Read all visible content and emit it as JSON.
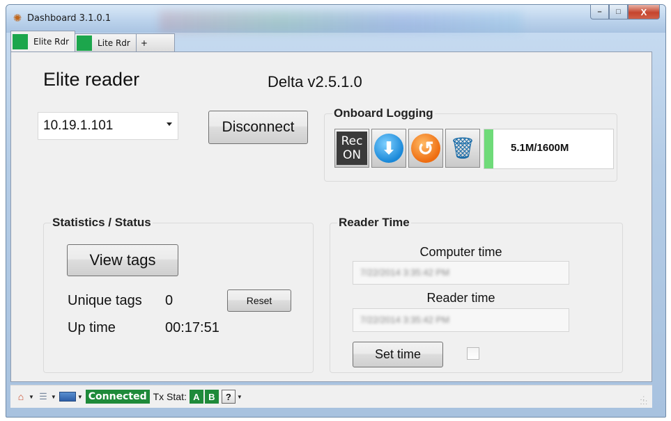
{
  "window": {
    "title": "Dashboard 3.1.0.1",
    "controls": {
      "minimize": "–",
      "maximize": "□",
      "close": "X"
    }
  },
  "tabs": [
    {
      "label": "Elite Rdr",
      "active": true,
      "color": "#1ca64c"
    },
    {
      "label": "Lite Rdr",
      "active": false,
      "color": "#1ca64c"
    },
    {
      "label": "+",
      "active": false
    }
  ],
  "header": {
    "reader_name": "Elite reader",
    "version": "Delta v2.5.1.0"
  },
  "connection": {
    "ip_address": "10.19.1.101",
    "disconnect_label": "Disconnect"
  },
  "logging": {
    "title": "Onboard Logging",
    "rec_line1": "Rec",
    "rec_line2": "ON",
    "storage_text": "5.1M/1600M",
    "storage_fraction": 0.0032,
    "tools": [
      "rec-on-icon",
      "download-icon",
      "reset-icon",
      "trash-icon"
    ]
  },
  "stats": {
    "title": "Statistics / Status",
    "view_tags_label": "View tags",
    "unique_tags_label": "Unique tags",
    "unique_tags_value": "0",
    "reset_label": "Reset",
    "uptime_label": "Up time",
    "uptime_value": "00:17:51"
  },
  "reader_time": {
    "title": "Reader Time",
    "computer_time_label": "Computer time",
    "computer_time_value": "7/22/2014 3:35:42 PM",
    "reader_time_label": "Reader time",
    "reader_time_value": "7/22/2014 3:35:42 PM",
    "set_time_label": "Set time",
    "auto_checked": false
  },
  "statusbar": {
    "connected_label": "Connected",
    "tx_stat_label": "Tx Stat:",
    "tx_a": "A",
    "tx_b": "B",
    "help": "?"
  },
  "colors": {
    "accent_green": "#1f8a3a",
    "storage_green": "#6fdb79"
  }
}
